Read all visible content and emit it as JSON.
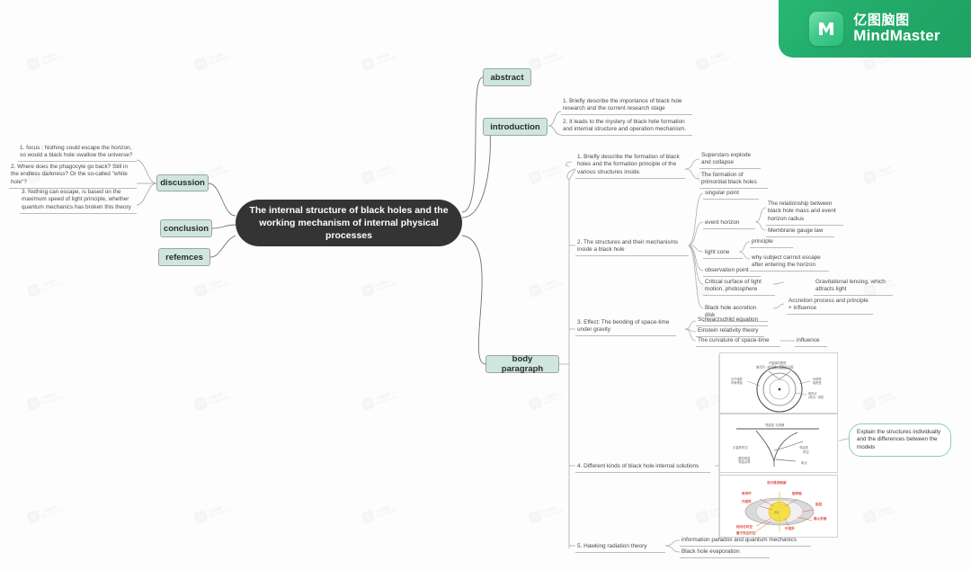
{
  "app": {
    "logo_cn": "亿图脑图",
    "logo_en": "MindMaster",
    "logo_icon": "mindmaster-logo-icon",
    "brand_color": "#28b873",
    "watermark_text_line1": "亿图脑图",
    "watermark_text_line2": "MindMaster"
  },
  "central": {
    "text": "The internal structure of black holes and the working mechanism of internal physical processes",
    "fill": "#343434",
    "text_color": "#ffffff"
  },
  "branches": {
    "discussion": "discussion",
    "conclusion": "conclusion",
    "refemces": "refemces",
    "abstract": "abstract",
    "introduction": "introduction",
    "body_paragraph": "body paragraph",
    "fill": "#cfe6df",
    "border": "#9aa6a4"
  },
  "discussion_items": [
    "1. focus : Nothing could escape the horizon, so would a black hole swallow the universe?",
    "2. Where does the phagocyte go back? Still in the endless darkness? Or the so-called \"white hole\"?",
    "3. Nothing can escape, is based on the maximum speed of light principle, whether quantum mechanics has broken this theory"
  ],
  "introduction_items": [
    "1. Briefly describe the importance of black hole research and the current research stage",
    "2. It leads to the mystery of black hole formation and internal structure and operation mechanism."
  ],
  "body": {
    "item1": {
      "label": "1. Briefly describe the formation of black holes and the formation principle of the various structures inside.",
      "children": [
        "Superstars explode and collapse",
        "The formation of primordial black holes"
      ]
    },
    "item2": {
      "label": "2. The structures and their mechanisms inside a black hole",
      "children": [
        {
          "label": "singular point",
          "children": []
        },
        {
          "label": "event horizon",
          "children": [
            "The relationship between black hole mass and event horizon radius",
            "Membrane gauge law"
          ]
        },
        {
          "label": "light cone",
          "children": [
            "principle",
            "why subject cannot escape after entering the horizon"
          ]
        },
        {
          "label": "observation point",
          "children": []
        },
        {
          "label": "Critical surface of light motion, photosphere",
          "children": [
            "Gravitational lensing, which attracts light"
          ]
        },
        {
          "label": "Black hole accretion disk",
          "children": [
            "Accretion process and principle + influence"
          ]
        }
      ]
    },
    "item3": {
      "label": "3. Effect: The bending of space-time under gravity",
      "children": [
        "Schwarzschild equation",
        "Einstein relativity theory",
        "The curvature of space-time"
      ],
      "grandchild": "influence"
    },
    "item4": {
      "label": "4. Different kinds of black hole internal solutions",
      "images": [
        {
          "name": "schwarzschild-black-hole-diagram",
          "caption_top": "不旋转的黑洞",
          "caption_top_sub": "施瓦西（史瓦西）黑洞示意图",
          "labels_left": [
            "光子球层",
            "时间界面"
          ],
          "labels_right": [
            "外视界",
            "吸积盘"
          ],
          "labels_inner": [
            "奇异点",
            "（奇点）深层"
          ]
        },
        {
          "name": "spacetime-curvature-diagram",
          "labels": [
            "弯曲变 无质解",
            "平直的时空",
            "重粒质量\n弯曲点阵",
            "弯曲的时空",
            "奇点"
          ]
        },
        {
          "name": "kerr-black-hole-diagram",
          "title": "克尔黑洞剖解",
          "labels": [
            "奇异环",
            "旋转轴",
            "内视界",
            "外视界",
            "能层",
            "静止界面",
            "相对论时空",
            "量子效应时空"
          ],
          "accent": "#e05a4f"
        }
      ],
      "callout": "Explain the structures individually and the differences between the models"
    },
    "item5": {
      "label": "5. Hawking radiation theory",
      "children": [
        "information paradox and quantum mechanics",
        "Black hole evaporation"
      ]
    }
  }
}
